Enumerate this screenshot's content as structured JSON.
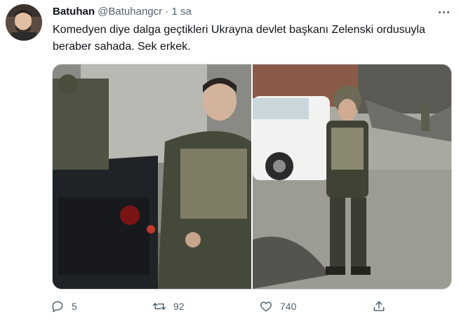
{
  "tweet": {
    "author_name": "Batuhan",
    "author_handle": "@Batuhangcr",
    "separator": "·",
    "time": "1 sa",
    "text": "Komedyen diye dalga geçtikleri Ukrayna devlet başkanı Zelenski ordusuyla\nberaber sahada. Sek erkek."
  },
  "media": {
    "photos": [
      "soldiers-beside-armored-vehicle",
      "leader-standing-by-white-suv"
    ]
  },
  "actions": {
    "reply_count": "5",
    "retweet_count": "92",
    "like_count": "740"
  },
  "icons": [
    "more-icon",
    "reply-icon",
    "retweet-icon",
    "like-icon",
    "share-icon"
  ],
  "colors": {
    "text": "#0f1419",
    "secondary": "#536471",
    "border": "#cfd9de"
  }
}
